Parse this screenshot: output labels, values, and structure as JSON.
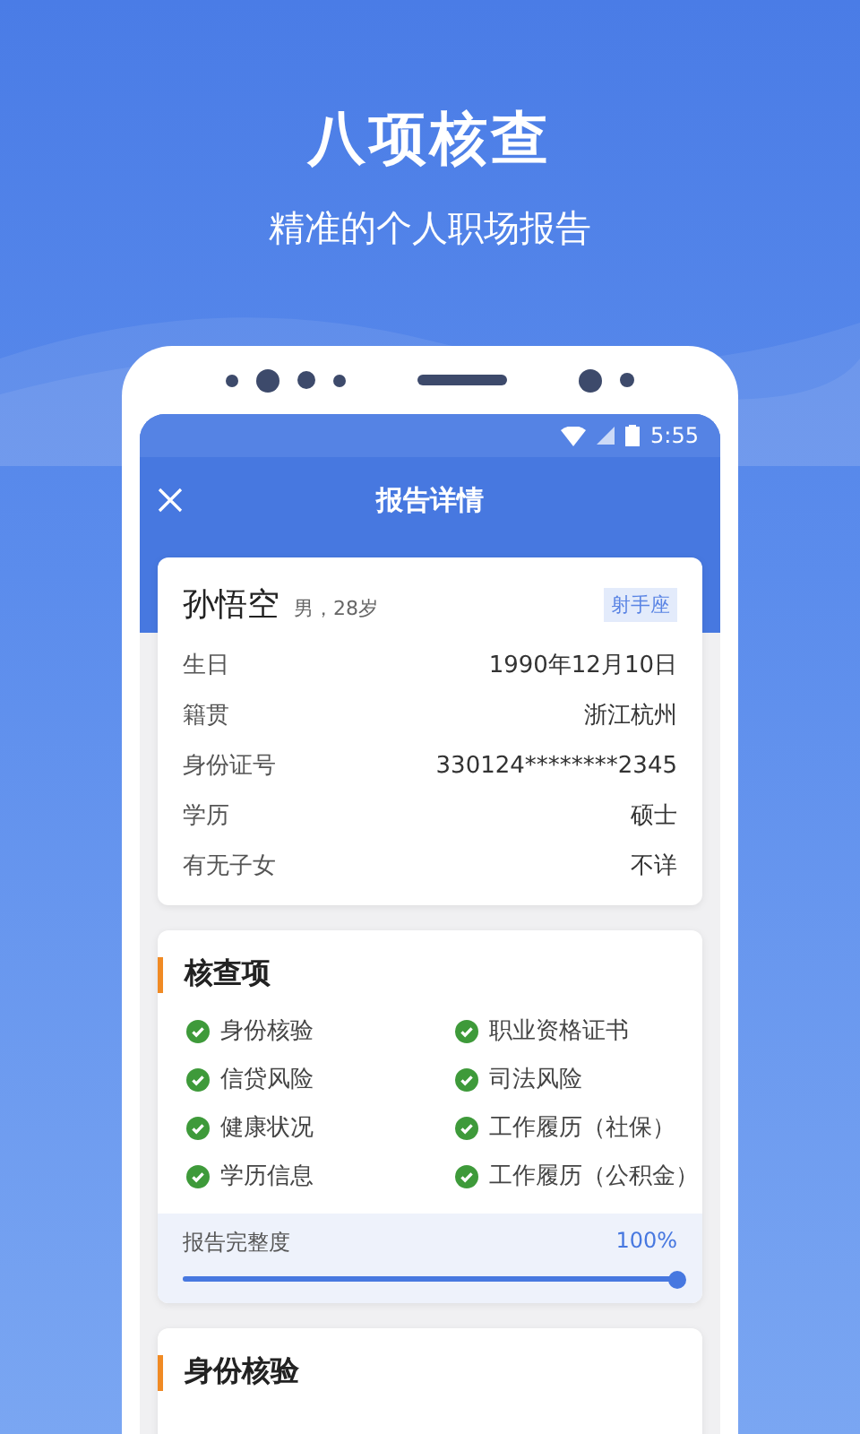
{
  "headline": "八项核查",
  "subtitle": "精准的个人职场报告",
  "status_bar": {
    "time": "5:55"
  },
  "app_bar": {
    "title": "报告详情"
  },
  "profile": {
    "name": "孙悟空",
    "meta": "男，28岁",
    "tag": "射手座",
    "rows": [
      {
        "label": "生日",
        "value": "1990年12月10日"
      },
      {
        "label": "籍贯",
        "value": "浙江杭州"
      },
      {
        "label": "身份证号",
        "value": "330124********2345"
      },
      {
        "label": "学历",
        "value": "硕士"
      },
      {
        "label": "有无子女",
        "value": "不详"
      }
    ]
  },
  "checks": {
    "title": "核查项",
    "items": [
      {
        "label": "身份核验",
        "checked": true
      },
      {
        "label": "职业资格证书",
        "checked": true
      },
      {
        "label": "信贷风险",
        "checked": true
      },
      {
        "label": "司法风险",
        "checked": true
      },
      {
        "label": "健康状况",
        "checked": true
      },
      {
        "label": "工作履历（社保）",
        "checked": true
      },
      {
        "label": "学历信息",
        "checked": true
      },
      {
        "label": "工作履历（公积金）",
        "checked": true
      }
    ],
    "completeness": {
      "label": "报告完整度",
      "reading": "100%",
      "level": 1
    }
  },
  "identity": {
    "title": "身份核验"
  }
}
